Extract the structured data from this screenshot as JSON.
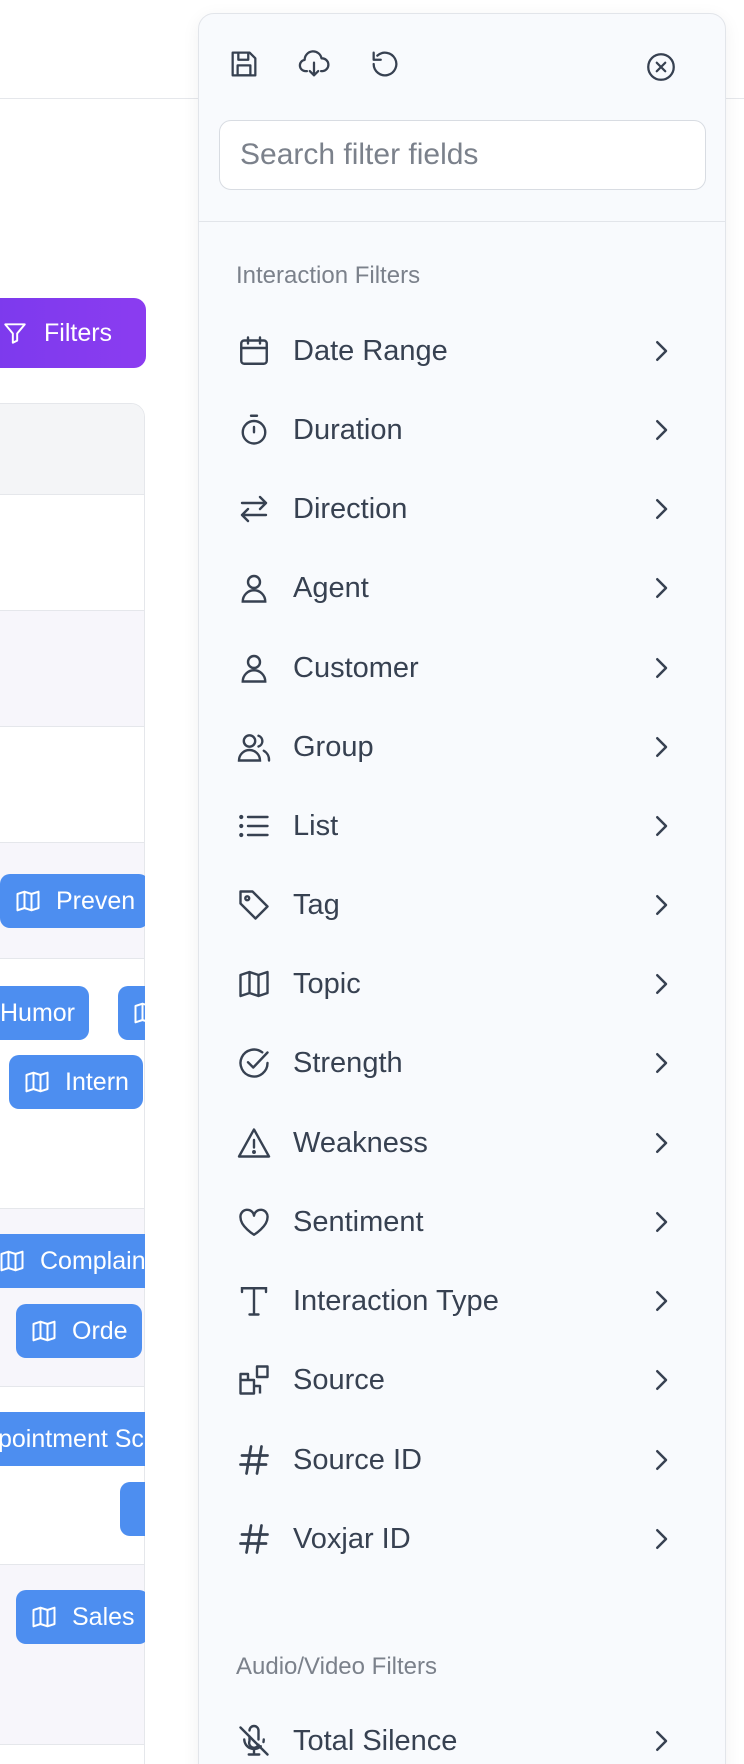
{
  "background": {
    "filters_button": "Filters",
    "chips": [
      "Preven",
      "Humor",
      "Intern",
      "Complain",
      "Orde",
      "pointment Sc",
      "Sales"
    ]
  },
  "panel": {
    "toolbar": {
      "save_icon": "save-icon",
      "download_icon": "cloud-download-icon",
      "reset_icon": "reset-icon",
      "close_icon": "close-circle-icon"
    },
    "search": {
      "placeholder": "Search filter fields",
      "value": ""
    },
    "sections": [
      {
        "title": "Interaction Filters",
        "items": [
          {
            "label": "Date Range",
            "icon": "calendar-icon"
          },
          {
            "label": "Duration",
            "icon": "stopwatch-icon"
          },
          {
            "label": "Direction",
            "icon": "arrows-swap-icon"
          },
          {
            "label": "Agent",
            "icon": "user-icon"
          },
          {
            "label": "Customer",
            "icon": "user-icon"
          },
          {
            "label": "Group",
            "icon": "users-icon"
          },
          {
            "label": "List",
            "icon": "list-icon"
          },
          {
            "label": "Tag",
            "icon": "tag-icon"
          },
          {
            "label": "Topic",
            "icon": "map-icon"
          },
          {
            "label": "Strength",
            "icon": "check-circle-icon"
          },
          {
            "label": "Weakness",
            "icon": "warning-icon"
          },
          {
            "label": "Sentiment",
            "icon": "heart-icon"
          },
          {
            "label": "Interaction Type",
            "icon": "text-type-icon"
          },
          {
            "label": "Source",
            "icon": "squares-plus-icon"
          },
          {
            "label": "Source ID",
            "icon": "hash-icon"
          },
          {
            "label": "Voxjar ID",
            "icon": "hash-icon"
          }
        ]
      },
      {
        "title": "Audio/Video Filters",
        "items": [
          {
            "label": "Total Silence",
            "icon": "mic-off-icon"
          }
        ]
      }
    ]
  }
}
